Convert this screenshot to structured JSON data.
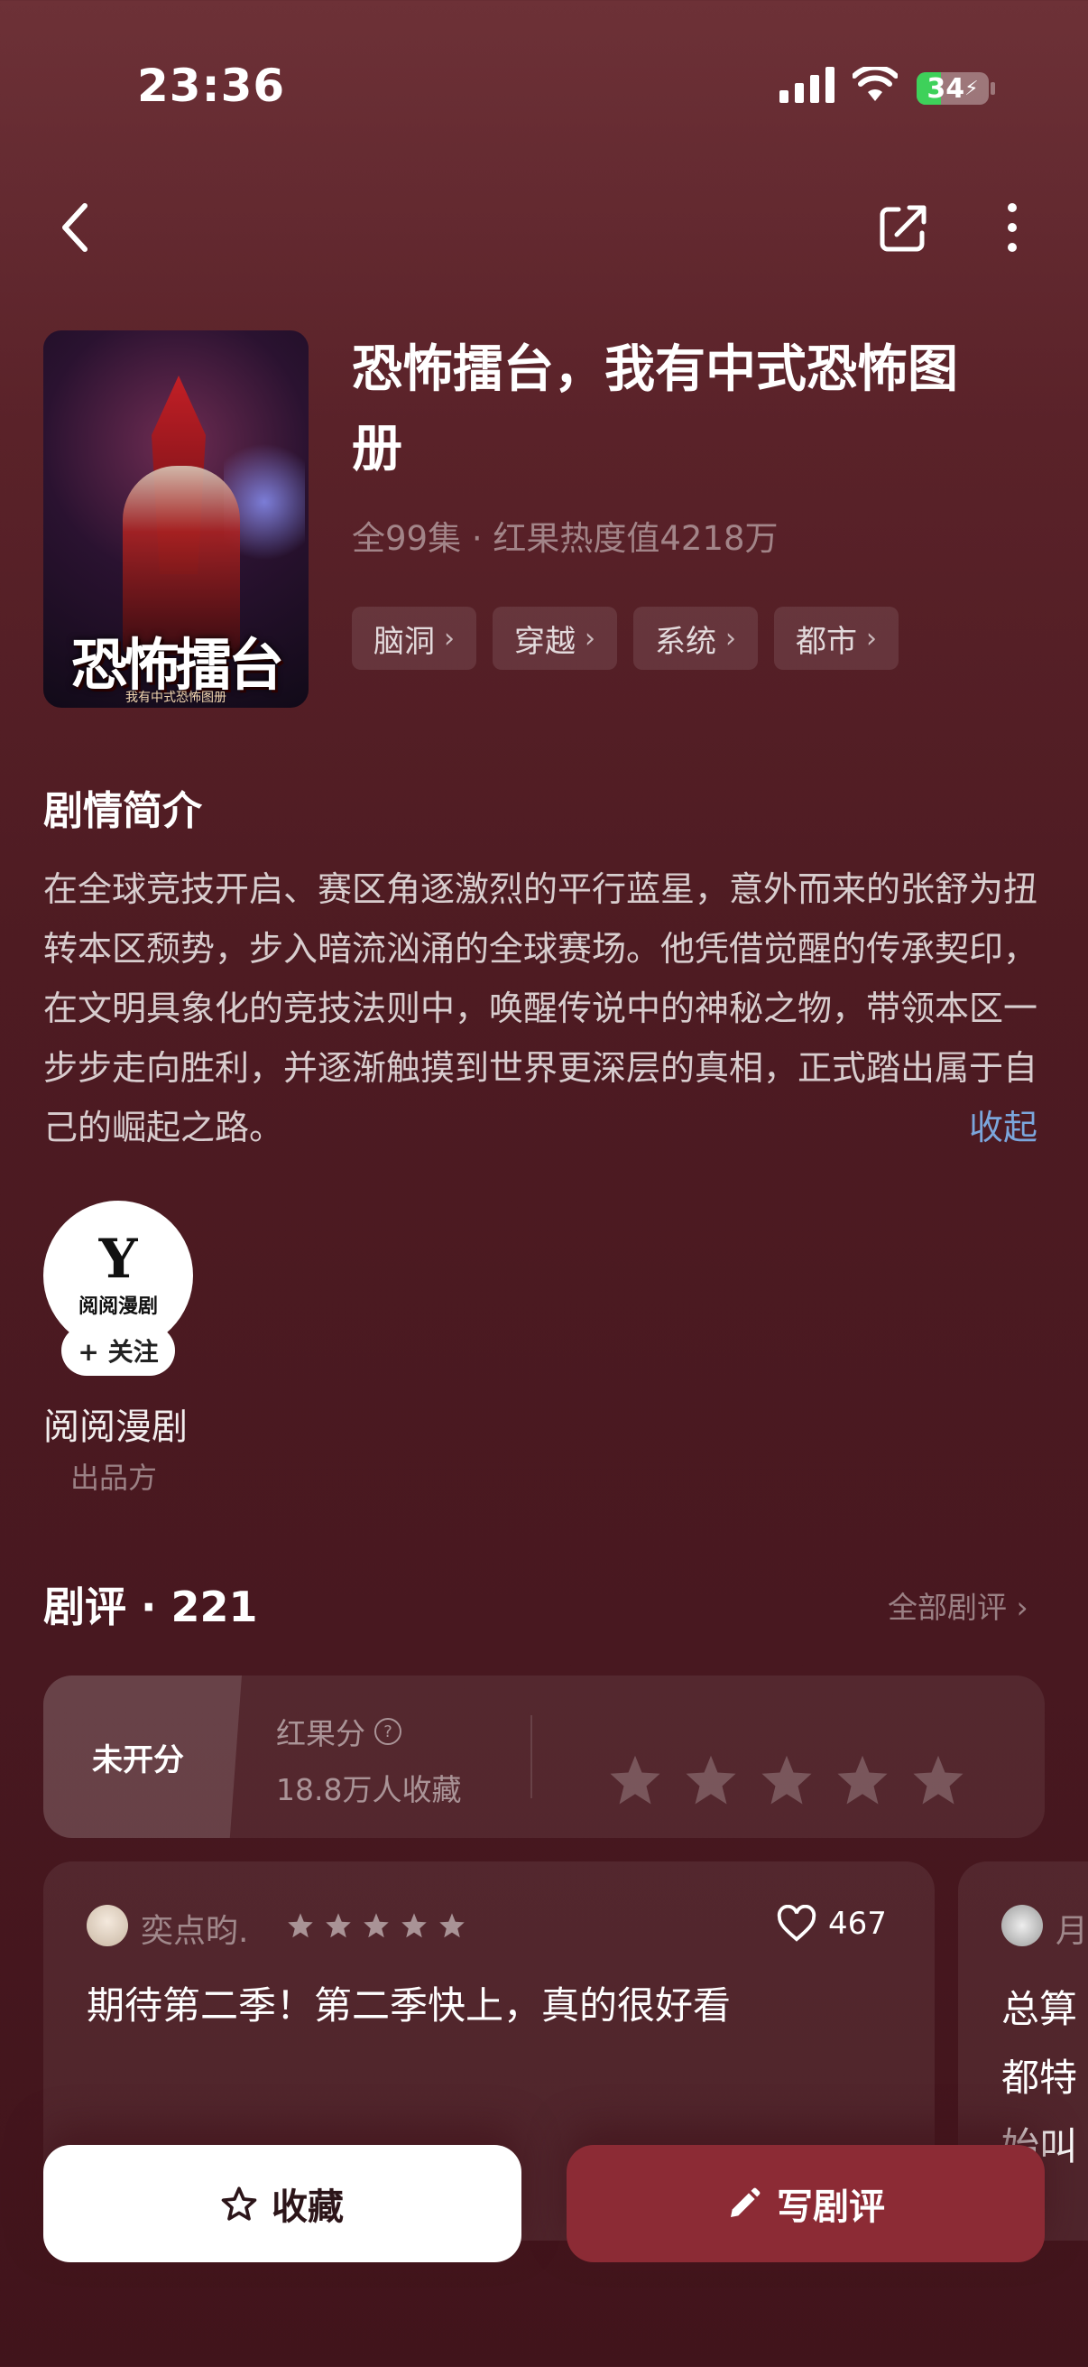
{
  "status_bar": {
    "time": "23:36",
    "battery_level": "34",
    "battery_fraction": 0.34,
    "icons": [
      "cellular-signal-icon",
      "wifi-icon",
      "battery-charging-icon"
    ]
  },
  "nav": {
    "icons": [
      "back-arrow-icon",
      "share-icon",
      "more-vertical-icon"
    ]
  },
  "drama": {
    "title": "恐怖擂台，我有中式恐怖图册",
    "meta": "全99集 · 红果热度值4218万",
    "cover_title": "恐怖擂台",
    "cover_subtitle": "我有中式恐怖图册",
    "tags": [
      {
        "label": "脑洞"
      },
      {
        "label": "穿越"
      },
      {
        "label": "系统"
      },
      {
        "label": "都市"
      }
    ]
  },
  "synopsis": {
    "heading": "剧情简介",
    "text": "在全球竞技开启、赛区角逐激烈的平行蓝星，意外而来的张舒为扭转本区颓势，步入暗流汹涌的全球赛场。他凭借觉醒的传承契印，在文明具象化的竞技法则中，唤醒传说中的神秘之物，带领本区一步步走向胜利，并逐渐触摸到世界更深层的真相，正式踏出属于自己的崛起之路。",
    "collapse_label": "收起",
    "link_color": "#7ba6dc"
  },
  "producer": {
    "logo_text": "阅阅漫剧",
    "follow_label": "+ 关注",
    "name": "阅阅漫剧",
    "role": "出品方"
  },
  "reviews": {
    "heading": "剧评 · 221",
    "all_label": "全部剧评 ›",
    "rating": {
      "unrated_label": "未开分",
      "score_label": "红果分",
      "favorites": "18.8万人收藏",
      "stars_total": 5
    },
    "items": [
      {
        "user": "奕点昀.",
        "stars": 5,
        "likes": "467",
        "text": "期待第二季！第二季快上，真的很好看"
      },
      {
        "user": "月",
        "text": "总算都特始叫"
      }
    ]
  },
  "actions": {
    "favorite_label": "收藏",
    "write_review_label": "写剧评",
    "accent_color": "#8c2b35"
  }
}
